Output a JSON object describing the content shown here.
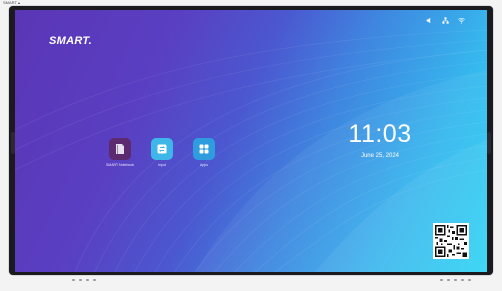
{
  "topbar": {
    "label": "SMART ▴"
  },
  "screen": {
    "logo": "SMART.",
    "status_icons": [
      "speaker-icon",
      "network-icon",
      "wifi-icon"
    ],
    "clock": {
      "time": "11:03",
      "date": "June 25, 2024"
    },
    "apps": [
      {
        "label": "SMART Notebook",
        "icon": "notebook-icon",
        "color": "#5c2a6e"
      },
      {
        "label": "Input",
        "icon": "input-switch-icon",
        "color": "#3fb6ea"
      },
      {
        "label": "Apps",
        "icon": "apps-grid-icon",
        "color": "#2f9ce0"
      }
    ],
    "qr_label": "qr-code"
  },
  "colors": {
    "gradient_start": "#5a36b6",
    "gradient_end": "#2ad3f5",
    "bezel": "#1a1a1f"
  }
}
